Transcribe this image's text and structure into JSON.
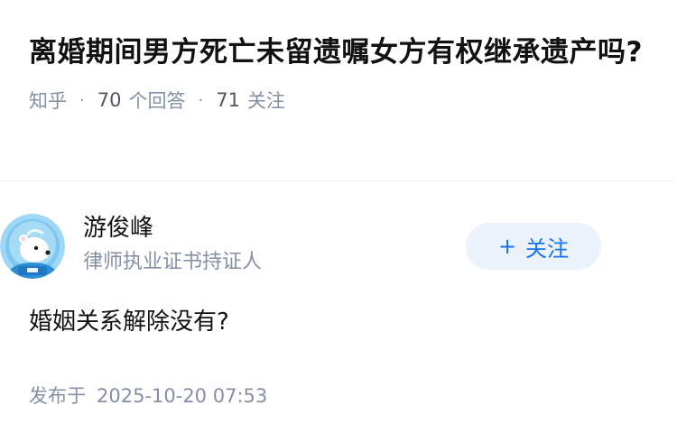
{
  "question": {
    "title": "离婚期间男方死亡未留遗嘱女方有权继承遗产吗?",
    "source": "知乎",
    "answer_count": "70",
    "answer_label": "个回答",
    "follower_count": "71",
    "follower_label": "关注"
  },
  "answer": {
    "author_name": "游俊峰",
    "author_badge": "律师执业证书持证人",
    "follow_label": "关注",
    "content": "婚姻关系解除没有?",
    "published_label": "发布于",
    "published_time": "2025-10-20 07:53"
  },
  "colors": {
    "accent": "#1772f6",
    "follow_bg": "#ebf2fb",
    "meta": "#8590a6",
    "title": "#121212"
  },
  "icons": {
    "avatar": "polar-bear-astronaut-avatar",
    "follow": "plus-icon"
  }
}
